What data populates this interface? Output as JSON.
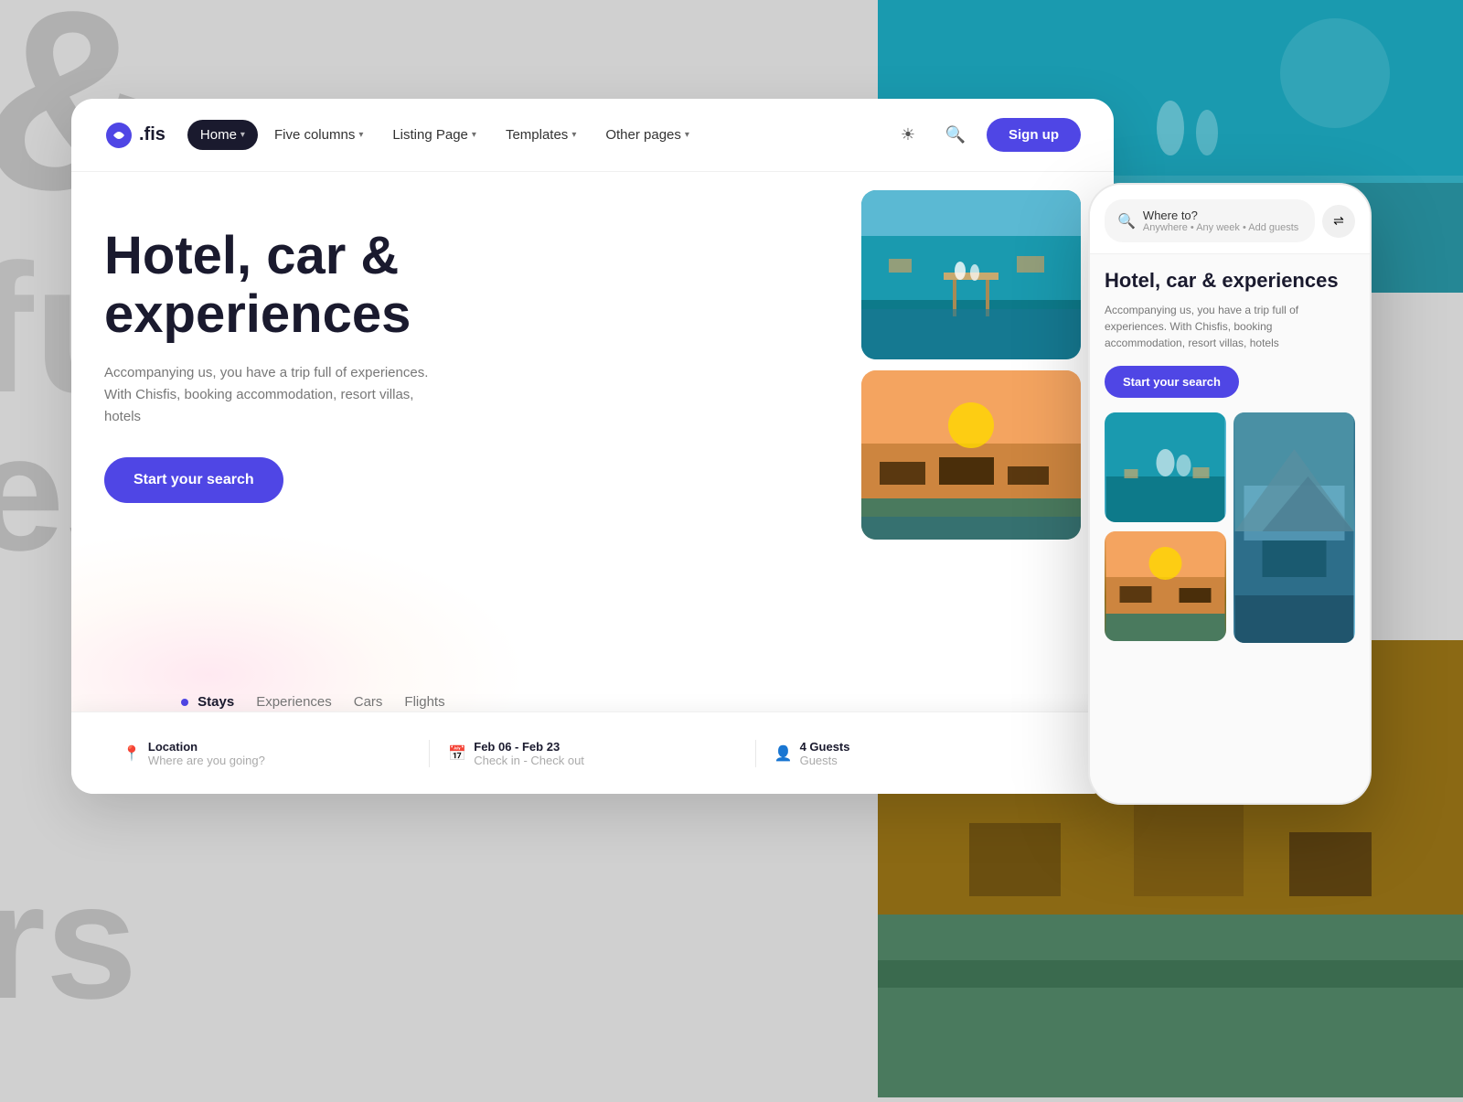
{
  "background": {
    "text1": "& ",
    "text2": "full o",
    "text3": "esor",
    "text4": "rs"
  },
  "navbar": {
    "logo_text": ".fis",
    "nav_items": [
      {
        "label": "Home",
        "active": true
      },
      {
        "label": "Five columns",
        "active": false
      },
      {
        "label": "Listing Page",
        "active": false
      },
      {
        "label": "Templates",
        "active": false
      },
      {
        "label": "Other pages",
        "active": false
      }
    ],
    "signup_label": "Sign up"
  },
  "hero": {
    "title": "Hotel, car & experiences",
    "description": "Accompanying us, you have a trip full of experiences. With Chisfis, booking accommodation, resort villas, hotels",
    "search_button": "Start your search"
  },
  "search_tabs": [
    {
      "label": "Stays",
      "active": true
    },
    {
      "label": "Experiences",
      "active": false
    },
    {
      "label": "Cars",
      "active": false
    },
    {
      "label": "Flights",
      "active": false
    }
  ],
  "search_fields": [
    {
      "label": "Location",
      "placeholder": "Where are you going?"
    },
    {
      "label": "Feb 06 - Feb 23",
      "placeholder": "Check in - Check out"
    },
    {
      "label": "4 Guests",
      "placeholder": "Guests"
    }
  ],
  "phone": {
    "search_label": "Where to?",
    "search_sub": "Anywhere • Any week • Add guests",
    "title": "Hotel, car & experiences",
    "description": "Accompanying us, you have a trip full of experiences. With Chisfis, booking accommodation, resort villas, hotels",
    "search_button": "Start your search"
  }
}
